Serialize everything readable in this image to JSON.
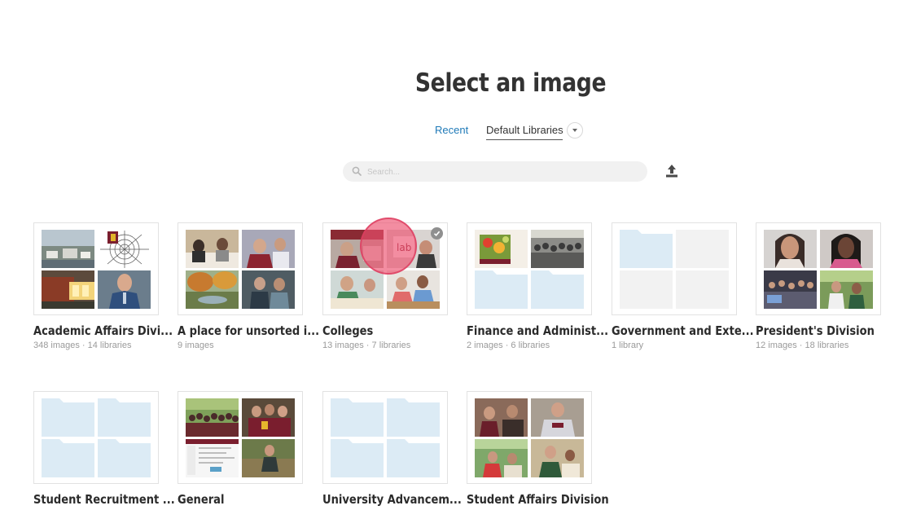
{
  "page": {
    "title": "Select an image"
  },
  "tabs": {
    "recent": "Recent",
    "default_libraries": "Default Libraries"
  },
  "search": {
    "placeholder": "Search..."
  },
  "icons": {
    "search": "search-icon",
    "upload": "upload-icon",
    "dropdown": "chevron-down-icon",
    "check": "checkmark-icon"
  },
  "colors": {
    "accent": "#1f7ab8",
    "folder": "#dcebf5",
    "placeholder": "#f2f2f2"
  },
  "libraries": [
    {
      "name": "Academic Affairs Divi...",
      "meta": "348 images · 14 libraries"
    },
    {
      "name": "A place for unsorted i...",
      "meta": "9 images"
    },
    {
      "name": "Colleges",
      "meta": "13 images · 7 libraries",
      "selected": true
    },
    {
      "name": "Finance and Administ...",
      "meta": "2 images · 6 libraries"
    },
    {
      "name": "Government and Exte...",
      "meta": "1 library"
    },
    {
      "name": "President's Division",
      "meta": "12 images · 18 libraries"
    },
    {
      "name": "Student Recruitment ...",
      "meta": ""
    },
    {
      "name": "General",
      "meta": ""
    },
    {
      "name": "University Advancem...",
      "meta": ""
    },
    {
      "name": "Student Affairs Division",
      "meta": ""
    }
  ]
}
